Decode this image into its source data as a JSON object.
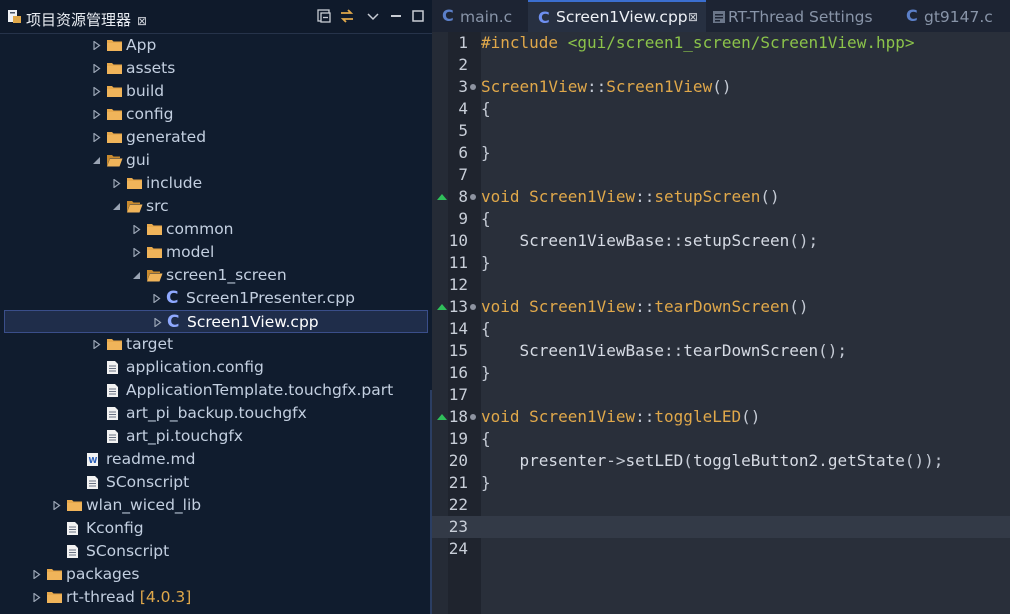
{
  "explorer": {
    "title": "项目资源管理器",
    "close_glyph": "⊠"
  },
  "tree": [
    {
      "label": "App",
      "type": "folder",
      "depth": 4,
      "open": false
    },
    {
      "label": "assets",
      "type": "folder",
      "depth": 4,
      "open": false
    },
    {
      "label": "build",
      "type": "folder",
      "depth": 4,
      "open": false
    },
    {
      "label": "config",
      "type": "folder",
      "depth": 4,
      "open": false
    },
    {
      "label": "generated",
      "type": "folder",
      "depth": 4,
      "open": false
    },
    {
      "label": "gui",
      "type": "folder",
      "depth": 4,
      "open": true
    },
    {
      "label": "include",
      "type": "folder",
      "depth": 5,
      "open": false
    },
    {
      "label": "src",
      "type": "folder",
      "depth": 5,
      "open": true
    },
    {
      "label": "common",
      "type": "folder",
      "depth": 6,
      "open": false
    },
    {
      "label": "model",
      "type": "folder",
      "depth": 6,
      "open": false
    },
    {
      "label": "screen1_screen",
      "type": "folder",
      "depth": 6,
      "open": true
    },
    {
      "label": "Screen1Presenter.cpp",
      "type": "cfile",
      "depth": 7,
      "open": false
    },
    {
      "label": "Screen1View.cpp",
      "type": "cfile",
      "depth": 7,
      "open": false,
      "selected": true
    },
    {
      "label": "target",
      "type": "folder",
      "depth": 4,
      "open": false
    },
    {
      "label": "application.config",
      "type": "file",
      "depth": 4
    },
    {
      "label": "ApplicationTemplate.touchgfx.part",
      "type": "file",
      "depth": 4
    },
    {
      "label": "art_pi_backup.touchgfx",
      "type": "file",
      "depth": 4
    },
    {
      "label": "art_pi.touchgfx",
      "type": "file",
      "depth": 4
    },
    {
      "label": "readme.md",
      "type": "wfile",
      "depth": 3
    },
    {
      "label": "SConscript",
      "type": "file",
      "depth": 3
    },
    {
      "label": "wlan_wiced_lib",
      "type": "folder",
      "depth": 2,
      "open": false
    },
    {
      "label": "Kconfig",
      "type": "file",
      "depth": 2
    },
    {
      "label": "SConscript",
      "type": "file",
      "depth": 2
    },
    {
      "label": "packages",
      "type": "folder",
      "depth": 1,
      "open": false
    },
    {
      "label": "rt-thread",
      "version": "[4.0.3]",
      "type": "folder",
      "depth": 1,
      "open": false
    }
  ],
  "tabs": [
    {
      "label": "main.c",
      "icon": "C"
    },
    {
      "label": "Screen1View.cpp",
      "icon": "C",
      "active": true,
      "close": "⊠"
    },
    {
      "label": "RT-Thread Settings",
      "icon": "settings"
    },
    {
      "label": "gt9147.c",
      "icon": "C"
    }
  ],
  "code": [
    {
      "n": "1",
      "parts": [
        [
          "inc-kw",
          "#include "
        ],
        [
          "inc",
          "<gui/screen1_screen/Screen1View.hpp>"
        ]
      ]
    },
    {
      "n": "2",
      "parts": []
    },
    {
      "n": "3",
      "fold": true,
      "parts": [
        [
          "fn",
          "Screen1View"
        ],
        [
          "pu",
          "::"
        ],
        [
          "fn",
          "Screen1View"
        ],
        [
          "pu",
          "()"
        ]
      ]
    },
    {
      "n": "4",
      "parts": [
        [
          "pu",
          "{"
        ]
      ]
    },
    {
      "n": "5",
      "parts": []
    },
    {
      "n": "6",
      "parts": [
        [
          "pu",
          "}"
        ]
      ]
    },
    {
      "n": "7",
      "parts": []
    },
    {
      "n": "8",
      "fold": true,
      "override": true,
      "parts": [
        [
          "kw",
          "void "
        ],
        [
          "fn",
          "Screen1View"
        ],
        [
          "pu",
          "::"
        ],
        [
          "fn",
          "setupScreen"
        ],
        [
          "pu",
          "()"
        ]
      ]
    },
    {
      "n": "9",
      "parts": [
        [
          "pu",
          "{"
        ]
      ]
    },
    {
      "n": "10",
      "parts": [
        [
          "pl",
          "    Screen1ViewBase"
        ],
        [
          "pu",
          "::"
        ],
        [
          "pl",
          "setupScreen"
        ],
        [
          "pu",
          "();"
        ]
      ]
    },
    {
      "n": "11",
      "parts": [
        [
          "pu",
          "}"
        ]
      ]
    },
    {
      "n": "12",
      "parts": []
    },
    {
      "n": "13",
      "fold": true,
      "override": true,
      "parts": [
        [
          "kw",
          "void "
        ],
        [
          "fn",
          "Screen1View"
        ],
        [
          "pu",
          "::"
        ],
        [
          "fn",
          "tearDownScreen"
        ],
        [
          "pu",
          "()"
        ]
      ]
    },
    {
      "n": "14",
      "parts": [
        [
          "pu",
          "{"
        ]
      ]
    },
    {
      "n": "15",
      "parts": [
        [
          "pl",
          "    Screen1ViewBase"
        ],
        [
          "pu",
          "::"
        ],
        [
          "pl",
          "tearDownScreen"
        ],
        [
          "pu",
          "();"
        ]
      ]
    },
    {
      "n": "16",
      "parts": [
        [
          "pu",
          "}"
        ]
      ]
    },
    {
      "n": "17",
      "parts": []
    },
    {
      "n": "18",
      "fold": true,
      "override": true,
      "parts": [
        [
          "kw",
          "void "
        ],
        [
          "fn",
          "Screen1View"
        ],
        [
          "pu",
          "::"
        ],
        [
          "fn",
          "toggleLED"
        ],
        [
          "pu",
          "()"
        ]
      ]
    },
    {
      "n": "19",
      "parts": [
        [
          "pu",
          "{"
        ]
      ]
    },
    {
      "n": "20",
      "parts": [
        [
          "pl",
          "    presenter"
        ],
        [
          "pu",
          "->"
        ],
        [
          "pl",
          "setLED"
        ],
        [
          "pu",
          "("
        ],
        [
          "pl",
          "toggleButton2"
        ],
        [
          "pu",
          "."
        ],
        [
          "pl",
          "getState"
        ],
        [
          "pu",
          "());"
        ]
      ]
    },
    {
      "n": "21",
      "parts": [
        [
          "pu",
          "}"
        ]
      ]
    },
    {
      "n": "22",
      "parts": []
    },
    {
      "n": "23",
      "parts": [],
      "current": true
    },
    {
      "n": "24",
      "parts": []
    }
  ]
}
